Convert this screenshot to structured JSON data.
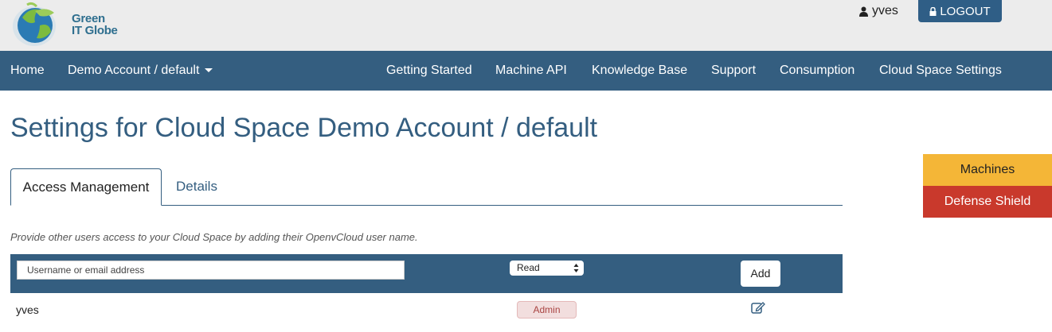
{
  "header": {
    "logo_line1": "Green",
    "logo_line2": "IT Globe",
    "username": "yves",
    "logout_label": "LOGOUT"
  },
  "nav": {
    "home": "Home",
    "account": "Demo Account / default",
    "items": [
      "Getting Started",
      "Machine API",
      "Knowledge Base",
      "Support",
      "Consumption",
      "Cloud Space Settings"
    ]
  },
  "page": {
    "title": "Settings for Cloud Space Demo Account / default"
  },
  "tabs": [
    "Access Management",
    "Details"
  ],
  "access": {
    "help_text": "Provide other users access to your Cloud Space by adding their OpenvCloud user name.",
    "input_placeholder": "Username or email address",
    "role_selected": "Read",
    "add_label": "Add",
    "users": [
      {
        "name": "yves",
        "role": "Admin"
      }
    ]
  },
  "side_buttons": {
    "machines": "Machines",
    "defense_shield": "Defense Shield"
  },
  "colors": {
    "primary": "#345e80",
    "header_bg": "#ececec",
    "machines": "#f4b637",
    "defense_shield": "#c9392c",
    "admin_badge_bg": "#f2dede",
    "admin_badge_text": "#a94442"
  }
}
